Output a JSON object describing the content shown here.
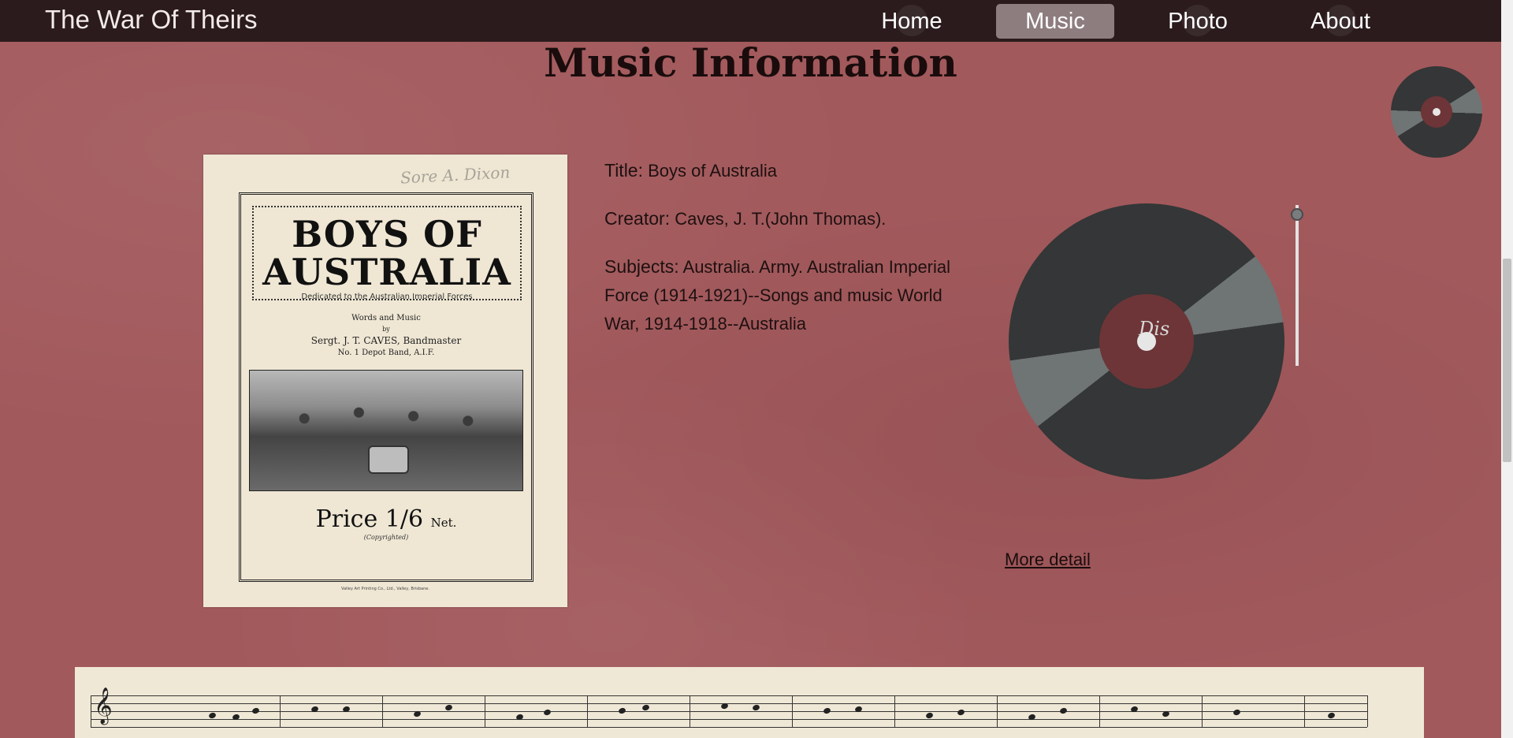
{
  "nav": {
    "brand": "The War Of Theirs",
    "items": [
      {
        "label": "Home",
        "active": false
      },
      {
        "label": "Music",
        "active": true
      },
      {
        "label": "Photo",
        "active": false
      },
      {
        "label": "About",
        "active": false
      }
    ]
  },
  "page": {
    "title": "Music Information"
  },
  "cover": {
    "title_line1": "BOYS OF",
    "title_line2": "AUSTRALIA",
    "dedication": "Dedicated to the Australian Imperial Forces",
    "words_line1": "Words and Music",
    "words_line2": "by",
    "words_line3": "Sergt. J. T. CAVES, Bandmaster",
    "words_line4": "No. 1 Depot Band, A.I.F.",
    "price_main": "Price 1/6",
    "price_suffix": "Net.",
    "copyright": "(Copyrighted)",
    "printer": "Valley Art Printing Co., Ltd., Valley, Brisbane."
  },
  "info": {
    "title_label": "Title:",
    "title_value": "Boys of Australia",
    "creator_label": "Creator:",
    "creator_value": "Caves, J. T.(John Thomas).",
    "subjects_label": "Subjects:",
    "subjects_value": "Australia. Army. Australian Imperial Force (1914-1921)--Songs and music World War, 1914-1918--Australia"
  },
  "player": {
    "label_text": "Dis",
    "more_detail": "More detail"
  },
  "colors": {
    "nav_bg": "#2b1b1c",
    "page_bg": "#a2595c",
    "active_nav": "#8e7d7f",
    "record": "#343637",
    "record_label": "#6d3537"
  },
  "icons": {
    "vinyl": "vinyl-record-icon",
    "tonearm": "tonearm-slider-icon"
  }
}
